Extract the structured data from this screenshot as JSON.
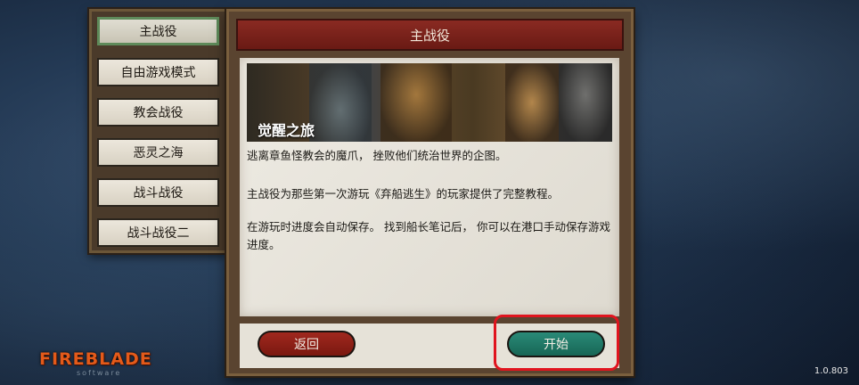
{
  "menu": {
    "items": [
      {
        "label": "主战役",
        "active": true
      },
      {
        "label": "自由游戏模式",
        "active": false
      },
      {
        "label": "教会战役",
        "active": false
      },
      {
        "label": "恶灵之海",
        "active": false
      },
      {
        "label": "战斗战役",
        "active": false
      },
      {
        "label": "战斗战役二",
        "active": false
      }
    ]
  },
  "panel": {
    "title": "主战役",
    "banner_title": "觉醒之旅",
    "paragraphs": [
      "逃离章鱼怪教会的魔爪， 挫败他们统治世界的企图。",
      "主战役为那些第一次游玩《弃船逃生》的玩家提供了完整教程。",
      "在游玩时进度会自动保存。 找到船长笔记后， 你可以在港口手动保存游戏进度。"
    ],
    "back_label": "返回",
    "start_label": "开始"
  },
  "logo": {
    "text": "FIREBLADE",
    "sub": "software"
  },
  "version": "1.0.803",
  "colors": {
    "title_bar": "#7a2018",
    "back_button": "#8a1f16",
    "start_button": "#1f7a68",
    "highlight": "#e0141e"
  }
}
